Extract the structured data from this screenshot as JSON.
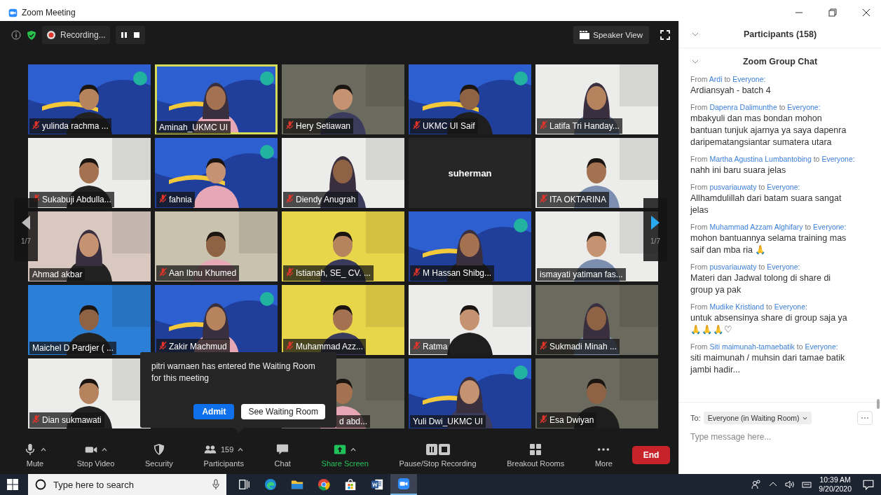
{
  "window": {
    "title": "Zoom Meeting"
  },
  "meeting_bar": {
    "recording_label": "Recording...",
    "view_button": "Speaker View"
  },
  "tiles": [
    {
      "kind": "video",
      "name": "yulinda rachma ...",
      "muted": true,
      "active": false
    },
    {
      "kind": "video",
      "name": "Aminah_UKMC UI",
      "muted": false,
      "active": true
    },
    {
      "kind": "video",
      "name": "Hery Setiawan",
      "muted": true,
      "active": false
    },
    {
      "kind": "video",
      "name": "UKMC UI Saif",
      "muted": true,
      "active": false
    },
    {
      "kind": "video",
      "name": "Latifa Tri Handay...",
      "muted": true,
      "active": false
    },
    {
      "kind": "video",
      "name": "Sukabuji Abdulla...",
      "muted": true,
      "active": false
    },
    {
      "kind": "video",
      "name": "fahnia",
      "muted": true,
      "active": false
    },
    {
      "kind": "video",
      "name": "Diendy Anugrah",
      "muted": true,
      "active": false
    },
    {
      "kind": "name_only",
      "name": "suherman",
      "muted": false,
      "active": false
    },
    {
      "kind": "video",
      "name": "ITA OKTARINA",
      "muted": true,
      "active": false
    },
    {
      "kind": "video",
      "name": "Ahmad akbar",
      "muted": false,
      "active": false
    },
    {
      "kind": "video",
      "name": "Aan Ibnu Khumed",
      "muted": true,
      "active": false
    },
    {
      "kind": "video",
      "name": "Istianah, SE_ CV. ...",
      "muted": true,
      "active": false
    },
    {
      "kind": "video",
      "name": "M Hassan Shibg...",
      "muted": true,
      "active": false
    },
    {
      "kind": "video",
      "name": "ismayati yatiman fas...",
      "muted": false,
      "active": false
    },
    {
      "kind": "video",
      "name": "Maichel D Pardjer ( ...",
      "muted": false,
      "active": false
    },
    {
      "kind": "video",
      "name": "Zakir Machmud",
      "muted": true,
      "active": false
    },
    {
      "kind": "video",
      "name": "Muhammad Azz...",
      "muted": true,
      "active": false
    },
    {
      "kind": "video",
      "name": "Ratma",
      "muted": true,
      "active": false
    },
    {
      "kind": "video",
      "name": "Sukmadi Minah ...",
      "muted": true,
      "active": false
    },
    {
      "kind": "video",
      "name": "Dian sukmawati",
      "muted": true,
      "active": false
    },
    {
      "kind": "video",
      "name": "d abd...",
      "muted": false,
      "active": false
    },
    {
      "kind": "video",
      "name": "Yuli Dwi_UKMC UI",
      "muted": false,
      "active": false
    },
    {
      "kind": "video",
      "name": "Esa Dwiyan",
      "muted": true,
      "active": false
    }
  ],
  "pager": {
    "left": "1/7",
    "right": "1/7"
  },
  "notification": {
    "message": "pitri warnaen has entered the Waiting Room for this meeting",
    "admit": "Admit",
    "see": "See Waiting Room"
  },
  "toolbar": [
    {
      "kind": "mic",
      "label": "Mute",
      "caret": true
    },
    {
      "kind": "video",
      "label": "Stop Video",
      "caret": true
    },
    {
      "kind": "security",
      "label": "Security",
      "caret": false
    },
    {
      "kind": "participants",
      "label": "Participants",
      "count": "159",
      "caret": true
    },
    {
      "kind": "chat",
      "label": "Chat",
      "caret": false
    },
    {
      "kind": "share",
      "label": "Share Screen",
      "caret": true
    },
    {
      "kind": "recording",
      "label": "Pause/Stop Recording",
      "caret": false
    },
    {
      "kind": "breakout",
      "label": "Breakout Rooms",
      "caret": false
    },
    {
      "kind": "more",
      "label": "More",
      "caret": false
    }
  ],
  "end_button": "End",
  "panel": {
    "participants_header": "Participants (158)",
    "chat_header": "Zoom Group Chat",
    "messages": [
      {
        "from_label": "From",
        "sender": "Ardi",
        "to_label": "to",
        "recipient": "Everyone:",
        "text": "Ardiansyah - batch 4"
      },
      {
        "from_label": "From",
        "sender": "Dapenra Dalimunthe",
        "to_label": "to",
        "recipient": "Everyone:",
        "text": "mbakyuli dan mas bondan mohon bantuan tunjuk ajarnya ya saya dapenra daripematangsiantar sumatera utara"
      },
      {
        "from_label": "From",
        "sender": "Martha Agustina Lumbantobing",
        "to_label": "to",
        "recipient": "Everyone:",
        "text": "nahh ini baru suara jelas"
      },
      {
        "from_label": "From",
        "sender": "pusvariauwaty",
        "to_label": "to",
        "recipient": "Everyone:",
        "text": "Allhamdulillah dari batam suara sangat jelas"
      },
      {
        "from_label": "From",
        "sender": "Muhammad Azzam Alghifary",
        "to_label": "to",
        "recipient": "Everyone:",
        "text": "mohon bantuannya selama training mas saif dan mba ria 🙏"
      },
      {
        "from_label": "From",
        "sender": "pusvariauwaty",
        "to_label": "to",
        "recipient": "Everyone:",
        "text": "Materi dan Jadwal tolong di share di group ya pak"
      },
      {
        "from_label": "From",
        "sender": "Mudike Kristiand",
        "to_label": "to",
        "recipient": "Everyone:",
        "text": "untuk absensinya share di group saja ya🙏🙏🙏♡"
      },
      {
        "from_label": "From",
        "sender": "Siti maimunah-tamaebatik",
        "to_label": "to",
        "recipient": "Everyone:",
        "text": "siti maimunah / muhsin dari tamae batik jambi hadir..."
      }
    ],
    "to_label": "To:",
    "recipient": "Everyone (in Waiting Room)",
    "placeholder": "Type message here..."
  },
  "taskbar": {
    "search_placeholder": "Type here to search",
    "apps": [
      {
        "kind": "taskview",
        "selected": false
      },
      {
        "kind": "edge",
        "selected": false
      },
      {
        "kind": "explorer",
        "selected": false
      },
      {
        "kind": "chrome",
        "selected": false
      },
      {
        "kind": "store",
        "selected": false
      },
      {
        "kind": "word",
        "selected": false
      },
      {
        "kind": "zoom",
        "selected": true
      }
    ],
    "time": "10:39 AM",
    "date": "9/20/2020"
  }
}
